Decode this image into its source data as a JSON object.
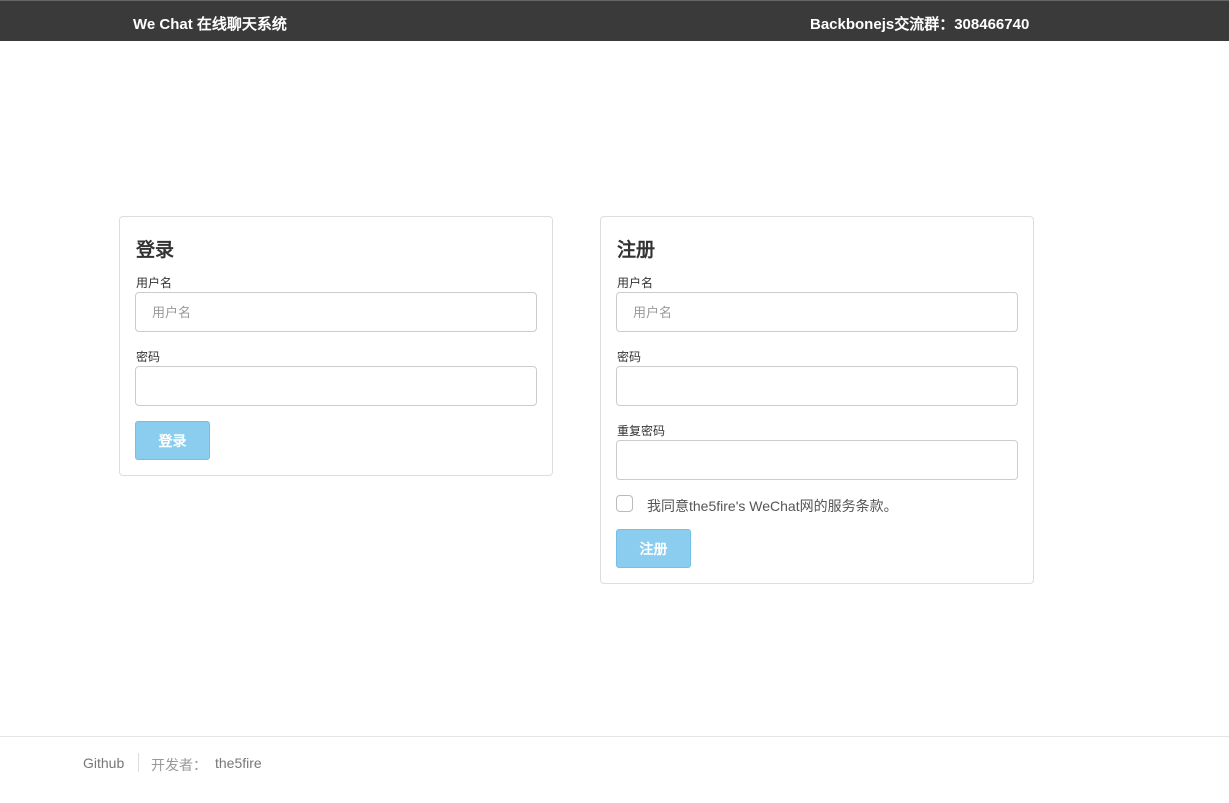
{
  "header": {
    "brand": "We Chat 在线聊天系统",
    "group_info": "Backbonejs交流群：308466740"
  },
  "login": {
    "title": "登录",
    "username_label": "用户名",
    "username_placeholder": "用户名",
    "password_label": "密码",
    "submit_label": "登录"
  },
  "register": {
    "title": "注册",
    "username_label": "用户名",
    "username_placeholder": "用户名",
    "password_label": "密码",
    "repeat_password_label": "重复密码",
    "terms_text": "我同意the5fire's WeChat网的服务条款。",
    "submit_label": "注册"
  },
  "footer": {
    "github_label": "Github",
    "developer_prefix": "开发者：",
    "developer_name": "the5fire"
  },
  "colors": {
    "topbar": "#3a3a3a",
    "button": "#8acdef"
  }
}
